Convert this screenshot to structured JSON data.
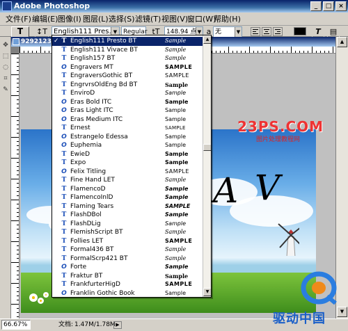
{
  "window": {
    "title": "Adobe Photoshop",
    "min": "_",
    "max": "□",
    "close": "×"
  },
  "menu": [
    "文件(F)",
    "编辑(E)",
    "图像(I)",
    "图层(L)",
    "选择(S)",
    "滤镜(T)",
    "视图(V)",
    "窗口(W)",
    "帮助(H)"
  ],
  "options": {
    "tool_preset": "T",
    "orientation_icon": "↕T",
    "font_family": "English111 Pres...",
    "font_style": "Regular",
    "font_size": "148.94 点",
    "size_icon": "tT",
    "aa_icon": "a",
    "antialias": "无",
    "dropdown_arrow": "▼",
    "warp_icon": "T",
    "palette_icon": "▤"
  },
  "document": {
    "title": "9292123_18..."
  },
  "status": {
    "zoom": "66.67%",
    "doc_label": "文档:",
    "doc_size": "1.47M/1.78M",
    "arrow": "▶"
  },
  "canvas": {
    "logo": "23PS.COM",
    "logo_sub": "图片处理教程网",
    "script_a": "A",
    "script_b": "V"
  },
  "brand": {
    "text": "驱动中国"
  },
  "font_list": [
    {
      "name": "English111 Presto BT",
      "type": "tt",
      "sample": "Sample",
      "selected": true,
      "style": "script"
    },
    {
      "name": "English111 Vivace BT",
      "type": "tt",
      "sample": "Sample",
      "style": "script"
    },
    {
      "name": "English157 BT",
      "type": "tt",
      "sample": "Sample",
      "style": "script"
    },
    {
      "name": "Engravers MT",
      "type": "ot",
      "sample": "SAMPLE",
      "style": "bold-caps"
    },
    {
      "name": "EngraversGothic BT",
      "type": "tt",
      "sample": "SAMPLE",
      "style": "caps"
    },
    {
      "name": "EngrvrsOldEng Bd BT",
      "type": "tt",
      "sample": "Sample",
      "style": "blackletter"
    },
    {
      "name": "EnviroD",
      "type": "tt",
      "sample": "Sample",
      "style": "italic"
    },
    {
      "name": "Eras Bold ITC",
      "type": "ot",
      "sample": "Sample",
      "style": "bold"
    },
    {
      "name": "Eras Light ITC",
      "type": "ot",
      "sample": "Sample",
      "style": "plain"
    },
    {
      "name": "Eras Medium ITC",
      "type": "ot",
      "sample": "Sample",
      "style": "plain"
    },
    {
      "name": "Ernest",
      "type": "tt",
      "sample": "SAMPLE",
      "style": "small-caps"
    },
    {
      "name": "Estrangelo Edessa",
      "type": "ot",
      "sample": "Sample",
      "style": "plain"
    },
    {
      "name": "Euphemia",
      "type": "ot",
      "sample": "Sample",
      "style": "plain"
    },
    {
      "name": "EwieD",
      "type": "tt",
      "sample": "Sample",
      "style": "bold"
    },
    {
      "name": "Expo",
      "type": "tt",
      "sample": "Sample",
      "style": "bold"
    },
    {
      "name": "Felix Titling",
      "type": "ot",
      "sample": "SAMPLE",
      "style": "caps"
    },
    {
      "name": "Fine Hand LET",
      "type": "tt",
      "sample": "Sample",
      "style": "script"
    },
    {
      "name": "FlamencoD",
      "type": "tt",
      "sample": "Sample",
      "style": "bold-italic"
    },
    {
      "name": "FlamencoInlD",
      "type": "tt",
      "sample": "Sample",
      "style": "bold-italic"
    },
    {
      "name": "Flaming Tears",
      "type": "tt",
      "sample": "SAMPLE",
      "style": "bold-caps-italic"
    },
    {
      "name": "FlashDBol",
      "type": "tt",
      "sample": "Sample",
      "style": "bold-italic"
    },
    {
      "name": "FlashDLig",
      "type": "tt",
      "sample": "Sample",
      "style": "italic"
    },
    {
      "name": "FlemishScript BT",
      "type": "tt",
      "sample": "Sample",
      "style": "script"
    },
    {
      "name": "Follies LET",
      "type": "tt",
      "sample": "SAMPLE",
      "style": "bold-caps"
    },
    {
      "name": "Formal436 BT",
      "type": "tt",
      "sample": "Sample",
      "style": "script"
    },
    {
      "name": "FormalScrp421 BT",
      "type": "tt",
      "sample": "Sample",
      "style": "script"
    },
    {
      "name": "Forte",
      "type": "ot",
      "sample": "Sample",
      "style": "bold-italic"
    },
    {
      "name": "Fraktur BT",
      "type": "tt",
      "sample": "Sample",
      "style": "blackletter"
    },
    {
      "name": "FrankfurterHigD",
      "type": "tt",
      "sample": "SAMPLE",
      "style": "bold-caps"
    },
    {
      "name": "Franklin Gothic Book",
      "type": "ot",
      "sample": "Sample",
      "style": "plain"
    }
  ]
}
